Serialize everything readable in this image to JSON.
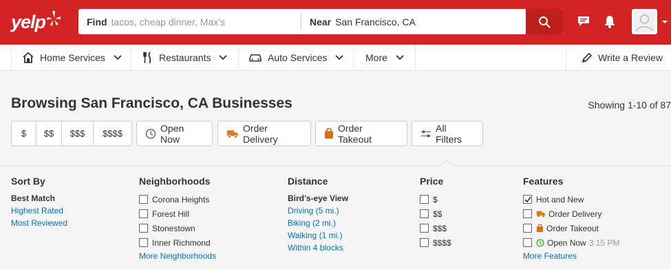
{
  "brand": {
    "logo_text": "yelp"
  },
  "search": {
    "find_label": "Find",
    "find_placeholder": "tacos, cheap dinner, Max’s",
    "near_label": "Near",
    "near_value": "San Francisco, CA"
  },
  "header_icons": [
    "search-icon",
    "chat-icon",
    "bell-icon",
    "avatar-icon"
  ],
  "categories": [
    {
      "label": "Home Services",
      "icon": "house-icon"
    },
    {
      "label": "Restaurants",
      "icon": "fork-knife-icon"
    },
    {
      "label": "Auto Services",
      "icon": "car-icon"
    },
    {
      "label": "More",
      "icon": ""
    }
  ],
  "write_review": "Write a Review",
  "page": {
    "title": "Browsing San Francisco, CA Businesses",
    "showing": "Showing 1-10 of 87"
  },
  "price_buttons": [
    "$",
    "$$",
    "$$$",
    "$$$$"
  ],
  "filter_buttons": {
    "open_now": "Open Now",
    "order_delivery": "Order Delivery",
    "order_takeout": "Order Takeout",
    "all_filters": "All Filters"
  },
  "sort_by": {
    "heading": "Sort By",
    "selected": "Best Match",
    "options": [
      "Highest Rated",
      "Most Reviewed"
    ]
  },
  "neighborhoods": {
    "heading": "Neighborhoods",
    "items": [
      "Corona Heights",
      "Forest Hill",
      "Stonestown",
      "Inner Richmond"
    ],
    "more": "More Neighborhoods"
  },
  "distance": {
    "heading": "Distance",
    "selected": "Bird’s-eye View",
    "options": [
      "Driving (5 mi.)",
      "Biking (2 mi.)",
      "Walking (1 mi.)",
      "Within 4 blocks"
    ]
  },
  "price": {
    "heading": "Price",
    "items": [
      "$",
      "$$",
      "$$$",
      "$$$$"
    ]
  },
  "features": {
    "heading": "Features",
    "items": [
      {
        "label": "Hot and New",
        "checked": true
      },
      {
        "label": "Order Delivery",
        "checked": false
      },
      {
        "label": "Order Takeout",
        "checked": false
      },
      {
        "label": "Open Now",
        "checked": false,
        "sub": "3:15 PM"
      }
    ],
    "more": "More Features"
  },
  "colors": {
    "brand_red": "#d32323",
    "search_btn": "#bd1f1f",
    "link_blue": "#0073bb",
    "orange_icon": "#f15c00",
    "green_clock": "#3db024"
  }
}
